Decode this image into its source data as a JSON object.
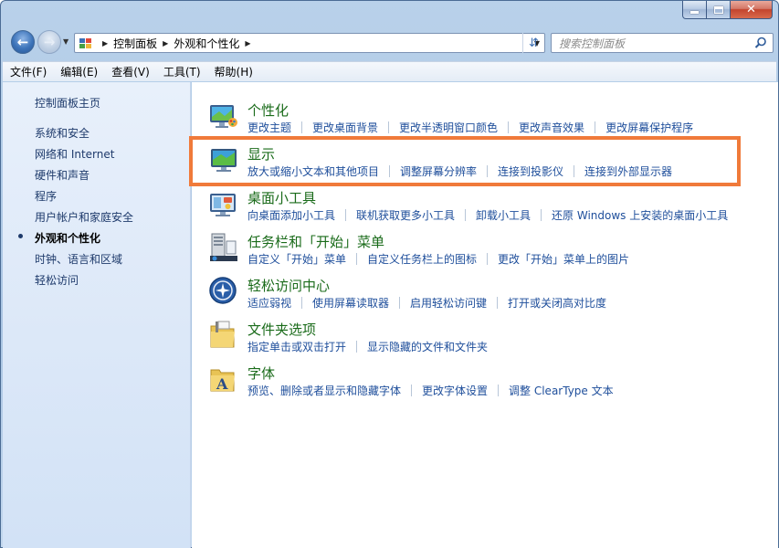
{
  "window": {
    "caption": {
      "minimize": "—",
      "maximize": "□",
      "close": "✕"
    }
  },
  "nav": {
    "back_icon": "back-arrow-icon",
    "forward_icon": "forward-arrow-icon",
    "breadcrumbs": [
      "控制面板",
      "外观和个性化"
    ],
    "search_placeholder": "搜索控制面板"
  },
  "menubar": {
    "items": [
      "文件(F)",
      "编辑(E)",
      "查看(V)",
      "工具(T)",
      "帮助(H)"
    ]
  },
  "sidebar": {
    "home": "控制面板主页",
    "items": [
      "系统和安全",
      "网络和 Internet",
      "硬件和声音",
      "程序",
      "用户帐户和家庭安全",
      "外观和个性化",
      "时钟、语言和区域",
      "轻松访问"
    ],
    "active_index": 5
  },
  "categories": [
    {
      "title": "个性化",
      "icon": "personalization-icon",
      "links": [
        "更改主题",
        "更改桌面背景",
        "更改半透明窗口颜色",
        "更改声音效果",
        "更改屏幕保护程序"
      ]
    },
    {
      "title": "显示",
      "icon": "display-icon",
      "links": [
        "放大或缩小文本和其他项目",
        "调整屏幕分辨率",
        "连接到投影仪",
        "连接到外部显示器"
      ]
    },
    {
      "title": "桌面小工具",
      "icon": "desktop-gadgets-icon",
      "links": [
        "向桌面添加小工具",
        "联机获取更多小工具",
        "卸载小工具",
        "还原 Windows 上安装的桌面小工具"
      ]
    },
    {
      "title": "任务栏和「开始」菜单",
      "icon": "taskbar-icon",
      "links": [
        "自定义「开始」菜单",
        "自定义任务栏上的图标",
        "更改「开始」菜单上的图片"
      ]
    },
    {
      "title": "轻松访问中心",
      "icon": "ease-of-access-icon",
      "links": [
        "适应弱视",
        "使用屏幕读取器",
        "启用轻松访问键",
        "打开或关闭高对比度"
      ]
    },
    {
      "title": "文件夹选项",
      "icon": "folder-options-icon",
      "links": [
        "指定单击或双击打开",
        "显示隐藏的文件和文件夹"
      ]
    },
    {
      "title": "字体",
      "icon": "fonts-icon",
      "links": [
        "预览、删除或者显示和隐藏字体",
        "更改字体设置",
        "调整 ClearType 文本"
      ]
    }
  ],
  "colors": {
    "highlight": "#f07a3a",
    "category_title": "#1a6b1a",
    "task_link": "#1e4e9b"
  }
}
